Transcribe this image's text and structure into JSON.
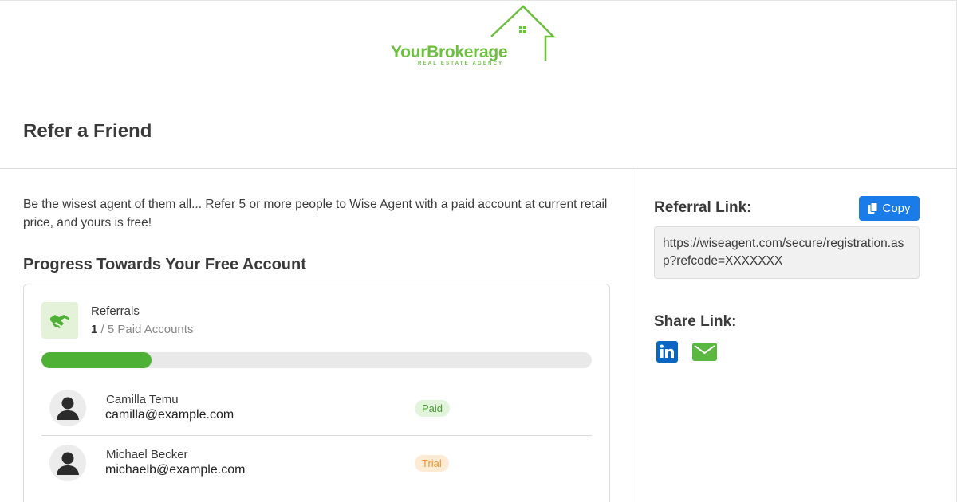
{
  "logo": {
    "name": "YourBrokerage",
    "tagline": "REAL ESTATE AGENCY",
    "color": "#6dbf3e"
  },
  "page": {
    "title": "Refer a Friend"
  },
  "main": {
    "intro": "Be the wisest agent of them all... Refer 5 or more people to Wise Agent with a paid account at current retail price, and yours is free!",
    "progress_heading": "Progress Towards Your Free Account",
    "referrals": {
      "icon": "handshake-icon",
      "label": "Referrals",
      "count": "1",
      "total_text": "/ 5 Paid Accounts",
      "progress_fraction": 0.2,
      "progress_color": "#4eb034"
    },
    "people": [
      {
        "name": "Camilla Temu",
        "email": "camilla@example.com",
        "status": "Paid",
        "status_color": "#4a9a36"
      },
      {
        "name": "Michael Becker",
        "email": "michaelb@example.com",
        "status": "Trial",
        "status_color": "#e9972e"
      }
    ]
  },
  "sidebar": {
    "referral_link_label": "Referral Link:",
    "copy_label": "Copy",
    "copy_icon": "copy-icon",
    "accent": "#1a7ce8",
    "referral_link": "https://wiseagent.com/secure/registration.asp?refcode=XXXXXXX",
    "share_label": "Share Link:",
    "share_icons": [
      "linkedin-icon",
      "email-icon"
    ]
  }
}
